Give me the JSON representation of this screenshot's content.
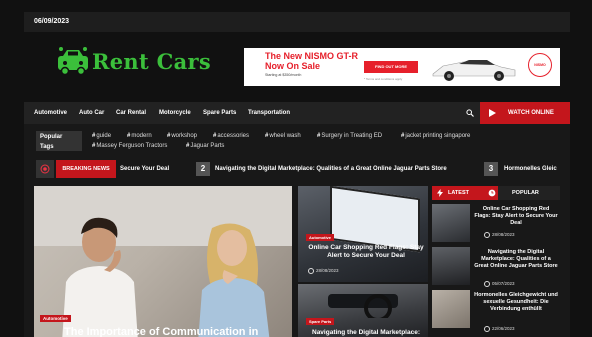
{
  "topbar": {
    "date": "06/09/2023"
  },
  "logo": {
    "text": "Rent Cars",
    "color": "#3bbf3b"
  },
  "ad": {
    "headline_line1": "The New NISMO GT-R",
    "headline_line2": "Now On Sale",
    "subline": "Starting at $350/month",
    "button": "FIND OUT MORE",
    "fine_print": "* Terms and conditions apply",
    "badge": "NISMO",
    "accent": "#e6202b"
  },
  "nav": {
    "items": [
      "Automotive",
      "Auto Car",
      "Car Rental",
      "Motorcycle",
      "Spare Parts",
      "Transportation"
    ],
    "search_icon": "search-icon",
    "watch_label": "WATCH ONLINE",
    "accent": "#c4161c"
  },
  "tags": {
    "label_line1": "Popular",
    "label_line2": "Tags",
    "items": [
      "guide",
      "modern",
      "workshop",
      "accessories",
      "wheel wash",
      "Surgery in Treating ED",
      "jacket printing singapore",
      "Massey Ferguson Tractors",
      "Jaguar Parts"
    ]
  },
  "ticker": {
    "label": "BREAKING NEWS",
    "items": [
      {
        "num": "",
        "text": "Secure Your Deal"
      },
      {
        "num": "2",
        "text": "Navigating the Digital Marketplace: Qualities of a Great Online Jaguar Parts Store"
      },
      {
        "num": "3",
        "text": "Hormonelles Gleic"
      }
    ]
  },
  "main_story": {
    "category": "Automotive",
    "title": "The Importance of Communication in"
  },
  "mid_stories": [
    {
      "category": "Automotive",
      "title": "Online Car Shopping Red Flags: Stay Alert to Secure Your Deal",
      "date": "28/08/2023"
    },
    {
      "category": "Spare Parts",
      "title": "Navigating the Digital Marketplace:"
    }
  ],
  "sidebar": {
    "tab_latest": "LATEST",
    "tab_popular": "POPULAR",
    "entries": [
      {
        "title": "Online Car Shopping Red Flags: Stay Alert to Secure Your Deal",
        "date": "28/08/2023"
      },
      {
        "title": "Navigating the Digital Marketplace: Qualities of a Great Online Jaguar Parts Store",
        "date": "05/07/2023"
      },
      {
        "title": "Hormonelles Gleichgewicht und sexuelle Gesundheit: Die Verbindung enthüllt",
        "date": "22/06/2023"
      }
    ]
  }
}
